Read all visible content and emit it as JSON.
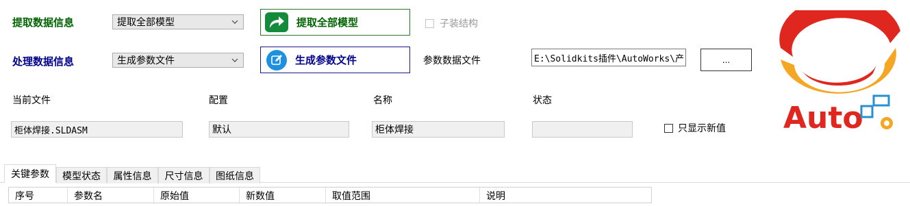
{
  "extract": {
    "label": "提取数据信息",
    "combo_value": "提取全部模型",
    "button_label": "提取全部模型",
    "checkbox_label": "子装结构"
  },
  "process": {
    "label": "处理数据信息",
    "combo_value": "生成参数文件",
    "button_label": "生成参数文件",
    "file_label": "参数数据文件",
    "file_path": "E:\\Solidkits插件\\AutoWorks\\产",
    "browse_label": "..."
  },
  "info": {
    "current_file_label": "当前文件",
    "current_file_value": "柜体焊接.SLDASM",
    "config_label": "配置",
    "config_value": "默认",
    "name_label": "名称",
    "name_value": "柜体焊接",
    "status_label": "状态",
    "status_value": "",
    "only_new_label": "只显示新值"
  },
  "logo": {
    "text": "Auto"
  },
  "tabs": [
    "关键参数",
    "模型状态",
    "属性信息",
    "尺寸信息",
    "图纸信息"
  ],
  "table": {
    "columns": [
      "序号",
      "参数名",
      "原始值",
      "新数值",
      "取值范围",
      "说明"
    ]
  },
  "colors": {
    "extract_green": "#006400",
    "process_blue": "#00008b",
    "logo_red": "#e0271f",
    "logo_orange": "#f5a623",
    "icon_blue": "#1e90e0"
  }
}
